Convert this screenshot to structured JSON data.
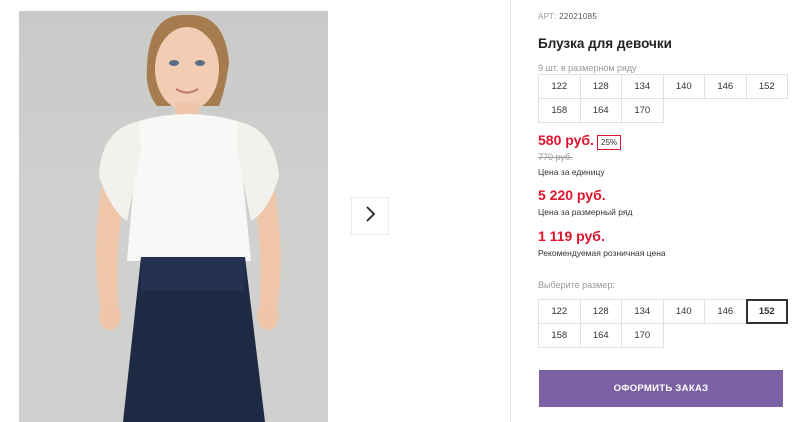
{
  "product": {
    "article_label": "АРТ:",
    "article_value": "22021085",
    "title": "Блузка для девочки",
    "row_count": "9 шт. в размерном ряду",
    "row_sizes": [
      "122",
      "128",
      "134",
      "140",
      "146",
      "152",
      "158",
      "164",
      "170"
    ],
    "price": "580 руб.",
    "discount": "25%",
    "old_price": "770 руб.",
    "price_note": "Цена за единицу",
    "row_price": "5 220 руб.",
    "row_price_note": "Цена за размерный ряд",
    "retail_price": "1 119 руб.",
    "retail_price_note": "Рекомендуемая розничная цена",
    "choose_size_label": "Выберите размер:",
    "choose_sizes": [
      "122",
      "128",
      "134",
      "140",
      "146",
      "152",
      "158",
      "164",
      "170"
    ],
    "selected_size": "152",
    "order_button": "ОФОРМИТЬ ЗАКАЗ"
  },
  "icons": {
    "next": "chevron-right-icon"
  },
  "colors": {
    "price": "#e0142d",
    "button": "#7b61a3"
  }
}
